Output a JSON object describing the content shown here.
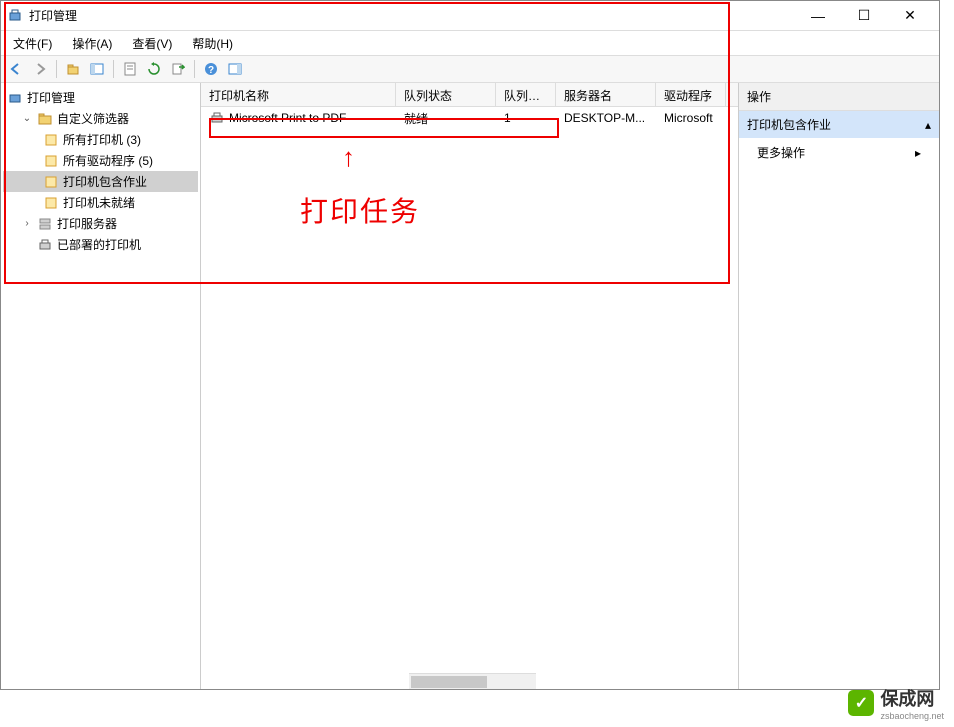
{
  "window": {
    "title": "打印管理",
    "controls": {
      "minimize": "—",
      "maximize": "☐",
      "close": "✕"
    }
  },
  "menubar": {
    "file": "文件(F)",
    "action": "操作(A)",
    "view": "查看(V)",
    "help": "帮助(H)"
  },
  "tree": {
    "root": "打印管理",
    "custom_filters": "自定义筛选器",
    "all_printers": "所有打印机 (3)",
    "all_drivers": "所有驱动程序 (5)",
    "printers_with_jobs": "打印机包含作业",
    "printers_not_ready": "打印机未就绪",
    "print_servers": "打印服务器",
    "deployed_printers": "已部署的打印机"
  },
  "list": {
    "headers": {
      "name": "打印机名称",
      "queue_status": "队列状态",
      "jobs_in_queue": "队列中...",
      "server_name": "服务器名",
      "driver": "驱动程序"
    },
    "rows": [
      {
        "name": "Microsoft Print to PDF",
        "status": "就绪",
        "jobs": "1",
        "server": "DESKTOP-M...",
        "driver": "Microsoft"
      }
    ]
  },
  "actions": {
    "header": "操作",
    "section_title": "打印机包含作业",
    "more_actions": "更多操作"
  },
  "annotation": {
    "text": "打印任务"
  },
  "watermark": {
    "brand": "保成网",
    "url": "zsbaocheng.net"
  }
}
